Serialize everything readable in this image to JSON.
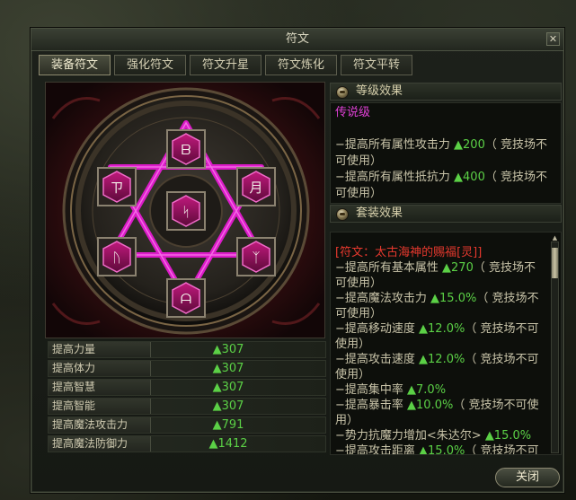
{
  "window": {
    "title": "符文",
    "close_glyph": "✕"
  },
  "tabs": [
    {
      "label": "装备符文",
      "active": true
    },
    {
      "label": "强化符文",
      "active": false
    },
    {
      "label": "符文升星",
      "active": false
    },
    {
      "label": "符文炼化",
      "active": false
    },
    {
      "label": "符文平转",
      "active": false
    }
  ],
  "runes": [
    {
      "slot": "top",
      "glyph": "ᗷ"
    },
    {
      "slot": "upper-left",
      "glyph": "ㄗ"
    },
    {
      "slot": "upper-right",
      "glyph": "月"
    },
    {
      "slot": "center",
      "glyph": "ᛋ"
    },
    {
      "slot": "lower-left",
      "glyph": "ᚢ"
    },
    {
      "slot": "lower-right",
      "glyph": "ᛉ"
    },
    {
      "slot": "bottom",
      "glyph": "ᗩ"
    }
  ],
  "stats": [
    {
      "label": "提高力量",
      "value": "▲307"
    },
    {
      "label": "提高体力",
      "value": "▲307"
    },
    {
      "label": "提高智慧",
      "value": "▲307"
    },
    {
      "label": "提高智能",
      "value": "▲307"
    },
    {
      "label": "提高魔法攻击力",
      "value": "▲791"
    },
    {
      "label": "提高魔法防御力",
      "value": "▲1412"
    }
  ],
  "grade": {
    "header": "等级效果",
    "name": "传说级",
    "lines": [
      {
        "text": "−提高所有属性攻击力 ",
        "val": "▲200",
        "note": "（ 竞技场不可使用）"
      },
      {
        "text": "−提高所有属性抵抗力 ",
        "val": "▲400",
        "note": "（ 竞技场不可使用）"
      }
    ]
  },
  "set": {
    "header": "套装效果",
    "name": "[符文：太古海神的赐福[灵]]",
    "lines": [
      {
        "text": "−提高所有基本属性 ",
        "val": "▲270",
        "note": "（ 竞技场不可使用）"
      },
      {
        "text": "−提高魔法攻击力 ",
        "val": "▲15.0%",
        "note": "（ 竞技场不可使用）"
      },
      {
        "text": "−提高移动速度 ",
        "val": "▲12.0%",
        "note": "（ 竞技场不可使用）"
      },
      {
        "text": "−提高攻击速度 ",
        "val": "▲12.0%",
        "note": "（ 竞技场不可使用）"
      },
      {
        "text": "−提高集中率 ",
        "val": "▲7.0%",
        "note": ""
      },
      {
        "text": "−提高暴击率 ",
        "val": "▲10.0%",
        "note": "（ 竞技场不可使用）"
      },
      {
        "text": "−势力抗魔力增加<朱达尔> ",
        "val": "▲15.0%",
        "note": ""
      },
      {
        "text": "−提高攻击距离 ",
        "val": "▲15.0%",
        "note": "（ 竞技场不可使用）"
      }
    ]
  },
  "buttons": {
    "close": "关闭"
  },
  "colors": {
    "accent_green": "#5bd046",
    "legend_purple": "#e040d6",
    "set_red": "#e8392e",
    "hexagram_pink": "#e61bd2"
  }
}
